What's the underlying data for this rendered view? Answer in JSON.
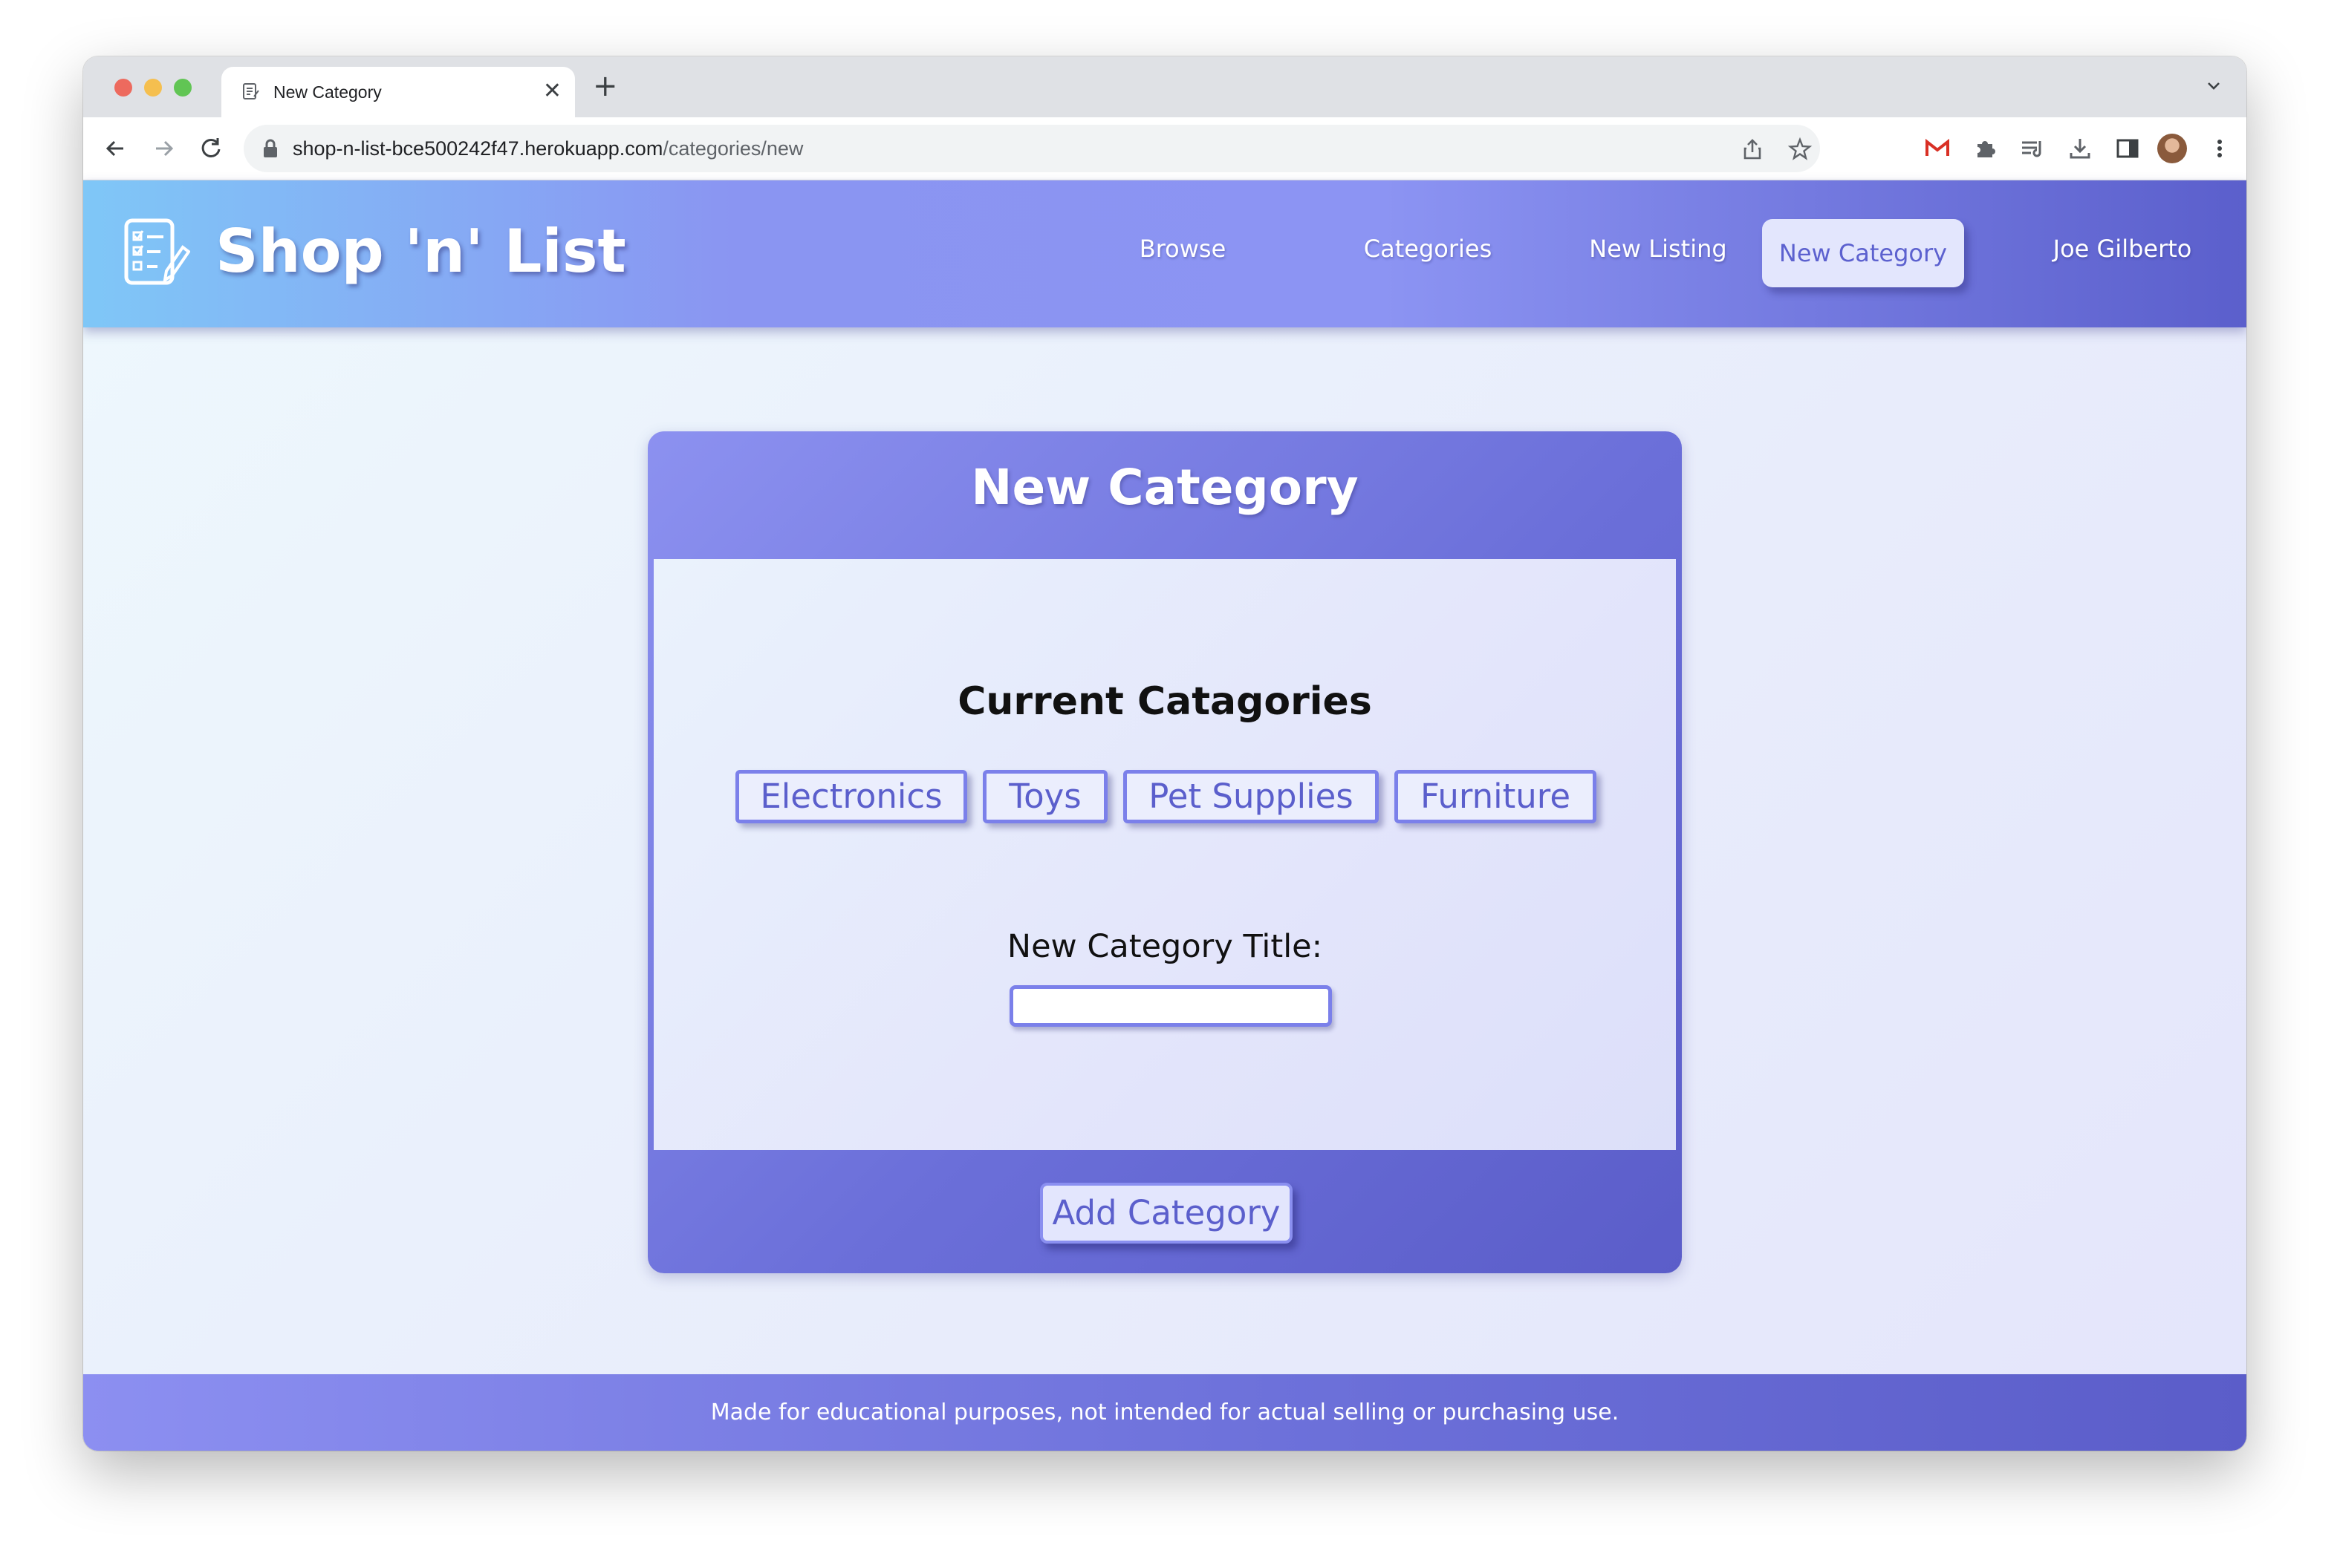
{
  "browser": {
    "tab_title": "New Category",
    "tab_close": "✕",
    "new_tab": "+",
    "url_host": "shop-n-list-bce500242f47.herokuapp.com",
    "url_path": "/categories/new"
  },
  "header": {
    "brand": "Shop 'n' List",
    "nav": [
      {
        "label": "Browse"
      },
      {
        "label": "Categories"
      },
      {
        "label": "New Listing"
      },
      {
        "label": "New Category",
        "active": true
      },
      {
        "label": "Joe Gilberto"
      }
    ]
  },
  "form": {
    "title": "New Category",
    "current_heading": "Current Catagories",
    "categories": [
      "Electronics",
      "Toys",
      "Pet Supplies",
      "Furniture"
    ],
    "field_label": "New Category Title:",
    "field_value": "",
    "submit_label": "Add Category"
  },
  "footer": {
    "text": "Made for educational purposes, not intended for actual selling or purchasing use."
  },
  "colors": {
    "accent": "#5b5fcc",
    "header_start": "#7fc7f7",
    "header_end": "#5b5fcc",
    "chip_border": "#7b80ea"
  },
  "icons": {
    "logo": "checklist-pencil-icon",
    "tab_favicon": "document-icon",
    "back": "arrow-left-icon",
    "forward": "arrow-right-icon",
    "reload": "reload-icon",
    "lock": "lock-icon",
    "share": "share-icon",
    "bookmark": "star-icon",
    "gmail": "gmail-icon",
    "extensions": "puzzle-icon",
    "reading_list": "reading-list-icon",
    "downloads": "download-icon",
    "side_panel": "side-panel-icon",
    "menu": "kebab-menu-icon"
  }
}
